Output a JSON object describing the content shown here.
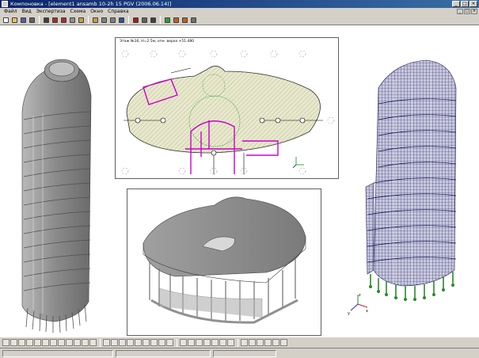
{
  "window": {
    "title": "Компоновка - [element1 ansamb 10-2h 15 PGV (2006.06.14)]"
  },
  "menubar": {
    "items": [
      "Файл",
      "Вид",
      "Экспертиза",
      "Схема",
      "Окно",
      "Справка"
    ]
  },
  "toolbar": {
    "icons": [
      "new-icon",
      "open-icon",
      "save-icon",
      "grid-icon",
      "zoom-icon",
      "pan-icon",
      "rotate-icon",
      "select-icon",
      "undo-icon",
      "redo-icon",
      "copy-icon",
      "paste-icon",
      "help-icon",
      "render-icon",
      "settings-icon",
      "print-icon",
      "filter-icon",
      "view-icon",
      "mesh-icon",
      "layer-icon"
    ]
  },
  "plan": {
    "title": "Этаж №16, Н=2.5м, отм. верха +51.480",
    "colors": {
      "fill": "#e8e8cc",
      "walls": "#cc00cc",
      "hatch": "#b0b090",
      "grid": "#808080",
      "circle": "#33aa33"
    }
  },
  "axes_label": {
    "x": "x",
    "y": "y",
    "z": "z"
  },
  "colors": {
    "mesh": "#2a2a8a",
    "supports": "#2a8a2a",
    "model": "#8a8a8a"
  }
}
